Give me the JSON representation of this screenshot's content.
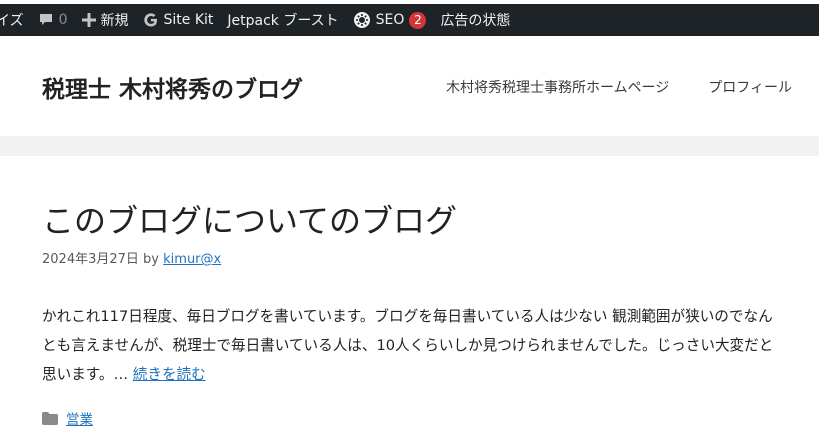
{
  "adminbar": {
    "customize": "イズ",
    "comments_count": "0",
    "new_label": "新規",
    "sitekit_label": "Site Kit",
    "jetpack_label": "Jetpack ブースト",
    "seo_label": "SEO",
    "seo_badge": "2",
    "ad_status": "広告の状態"
  },
  "header": {
    "site_title": "税理士 木村将秀のブログ",
    "nav": [
      "木村将秀税理士事務所ホームページ",
      "プロフィール"
    ]
  },
  "post": {
    "title": "このブログについてのブログ",
    "date": "2024年3月27日",
    "by": "by",
    "author": "kimur@x",
    "excerpt": "かれこれ117日程度、毎日ブログを書いています。ブログを毎日書いている人は少ない 観測範囲が狭いのでなんとも言えませんが、税理士で毎日書いている人は、10人くらいしか見つけられませんでした。じっさい大変だと思います。…",
    "read_more": "続きを読む",
    "category": "営業"
  }
}
